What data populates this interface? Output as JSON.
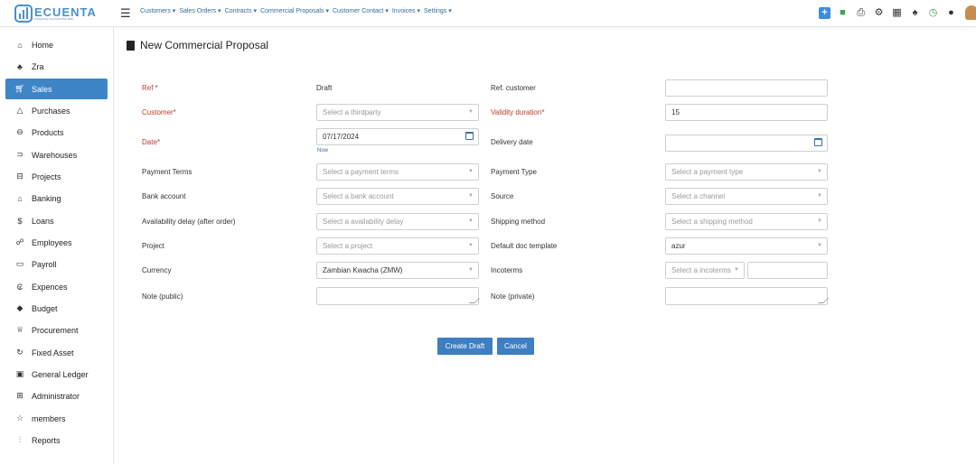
{
  "brand": {
    "name": "ECUENTA",
    "tagline": "FINANCIAL ACCOUNTING ERP"
  },
  "topnav": {
    "items": [
      {
        "label": "Customers"
      },
      {
        "label": "Sales Orders"
      },
      {
        "label": "Contracts"
      },
      {
        "label": "Commercial Proposals"
      },
      {
        "label": "Customer Contact"
      },
      {
        "label": "Invoices"
      },
      {
        "label": "Settings"
      }
    ],
    "icons": [
      "plus-icon",
      "chat-icon",
      "printer-icon",
      "gear-icon",
      "calendar-icon",
      "bell-icon",
      "clock-icon",
      "location-icon",
      "user-avatar"
    ]
  },
  "sidebar": {
    "items": [
      {
        "label": "Home",
        "icon": "home-icon"
      },
      {
        "label": "Zra",
        "icon": "group-icon"
      },
      {
        "label": "Sales",
        "icon": "cart-icon",
        "active": true
      },
      {
        "label": "Purchases",
        "icon": "bag-icon"
      },
      {
        "label": "Products",
        "icon": "box-icon"
      },
      {
        "label": "Warehouses",
        "icon": "truck-icon"
      },
      {
        "label": "Projects",
        "icon": "briefcase-icon"
      },
      {
        "label": "Banking",
        "icon": "bank-icon"
      },
      {
        "label": "Loans",
        "icon": "dollar-icon"
      },
      {
        "label": "Employees",
        "icon": "users-icon"
      },
      {
        "label": "Payroll",
        "icon": "payroll-icon"
      },
      {
        "label": "Expences",
        "icon": "receipt-icon"
      },
      {
        "label": "Budget",
        "icon": "budget-icon"
      },
      {
        "label": "Procurement",
        "icon": "procurement-icon"
      },
      {
        "label": "Fixed Asset",
        "icon": "asset-icon"
      },
      {
        "label": "General Ledger",
        "icon": "ledger-icon"
      },
      {
        "label": "Administrator",
        "icon": "admin-icon"
      },
      {
        "label": "members",
        "icon": "members-icon"
      },
      {
        "label": "Reports",
        "icon": "chart-icon"
      }
    ]
  },
  "page": {
    "title": "New Commercial Proposal"
  },
  "form": {
    "ref": {
      "label": "Ref *",
      "value": "Draft"
    },
    "ref_customer": {
      "label": "Ref. customer",
      "value": ""
    },
    "customer": {
      "label": "Customer*",
      "placeholder": "Select a thirdparty"
    },
    "validity": {
      "label": "Validity duration*",
      "value": "15"
    },
    "date": {
      "label": "Date*",
      "value": "07/17/2024",
      "now_link": "Now"
    },
    "delivery_date": {
      "label": "Delivery date",
      "value": ""
    },
    "payment_terms": {
      "label": "Payment Terms",
      "placeholder": "Select a payment terms"
    },
    "payment_type": {
      "label": "Payment Type",
      "placeholder": "Select a payment type"
    },
    "bank_account": {
      "label": "Bank account",
      "placeholder": "Select a bank account"
    },
    "source": {
      "label": "Source",
      "placeholder": "Select a channel"
    },
    "availability": {
      "label": "Availability delay (after order)",
      "placeholder": "Select a availability delay"
    },
    "shipping": {
      "label": "Shipping method",
      "placeholder": "Select a shipping method"
    },
    "project": {
      "label": "Project",
      "placeholder": "Select a project"
    },
    "doc_template": {
      "label": "Default doc template",
      "value": "azur"
    },
    "currency": {
      "label": "Currency",
      "value": "Zambian Kwacha (ZMW)"
    },
    "incoterms": {
      "label": "Incoterms",
      "placeholder": "Select a incoterms"
    },
    "note_public": {
      "label": "Note (public)"
    },
    "note_private": {
      "label": "Note (private)"
    }
  },
  "actions": {
    "create": "Create Draft",
    "cancel": "Cancel"
  },
  "colors": {
    "accent": "#3d85c6",
    "required": "#c0392b",
    "link": "#3a6b96"
  }
}
